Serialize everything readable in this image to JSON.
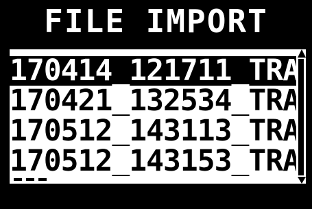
{
  "header": {
    "title": "FILE IMPORT"
  },
  "file_list": {
    "selected_index": 0,
    "items": [
      {
        "label": "170414_121711_TRA"
      },
      {
        "label": "170421_132534_TRA"
      },
      {
        "label": "170512_143113_TRA"
      },
      {
        "label": "170512_143153_TRA"
      }
    ]
  },
  "colors": {
    "background": "#000000",
    "foreground": "#ffffff",
    "selected_bg": "#000000",
    "selected_fg": "#ffffff"
  },
  "icons": {
    "scroll_up": "triangle-up-icon",
    "scroll_down": "triangle-down-icon"
  }
}
